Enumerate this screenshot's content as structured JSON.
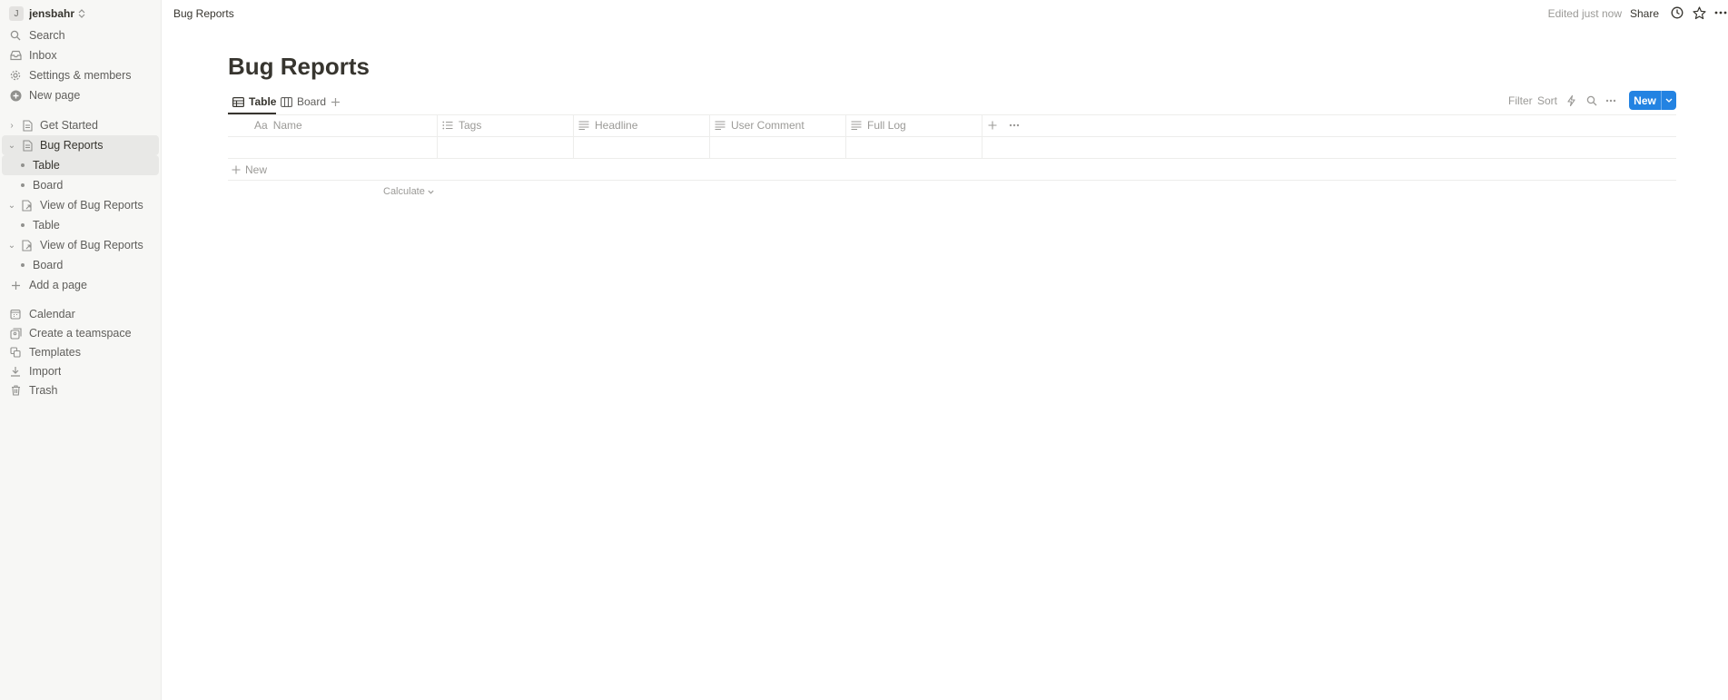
{
  "workspace": {
    "initial": "J",
    "name": "jensbahr"
  },
  "sidebar": {
    "top": [
      {
        "label": "Search",
        "icon": "search-icon"
      },
      {
        "label": "Inbox",
        "icon": "inbox-icon"
      },
      {
        "label": "Settings & members",
        "icon": "gear-icon"
      },
      {
        "label": "New page",
        "icon": "plus-circle-icon"
      }
    ],
    "pages": [
      {
        "label": "Get Started",
        "icon": "page-icon",
        "expanded": false
      },
      {
        "label": "Bug Reports",
        "icon": "page-icon",
        "expanded": true,
        "active": true
      },
      {
        "label": "Table",
        "child": true,
        "active": true
      },
      {
        "label": "Board",
        "child": true
      },
      {
        "label": "View of Bug Reports",
        "icon": "linked-page-icon",
        "expanded": true
      },
      {
        "label": "Table",
        "child": true
      },
      {
        "label": "View of Bug Reports",
        "icon": "linked-page-icon",
        "expanded": true
      },
      {
        "label": "Board",
        "child": true
      }
    ],
    "add_page": "Add a page",
    "bottom": [
      {
        "label": "Calendar",
        "icon": "calendar-icon"
      },
      {
        "label": "Create a teamspace",
        "icon": "teamspace-icon"
      },
      {
        "label": "Templates",
        "icon": "templates-icon"
      },
      {
        "label": "Import",
        "icon": "import-icon"
      },
      {
        "label": "Trash",
        "icon": "trash-icon"
      }
    ]
  },
  "topbar": {
    "breadcrumb": "Bug Reports",
    "edited": "Edited just now",
    "share": "Share"
  },
  "page": {
    "title": "Bug Reports",
    "views": [
      {
        "label": "Table",
        "active": true
      },
      {
        "label": "Board"
      }
    ],
    "tools": {
      "filter": "Filter",
      "sort": "Sort",
      "new": "New"
    },
    "columns": [
      {
        "label": "Name",
        "prefix": "Aa"
      },
      {
        "label": "Tags",
        "icon": "multiselect-icon"
      },
      {
        "label": "Headline",
        "icon": "text-icon"
      },
      {
        "label": "User Comment",
        "icon": "text-icon"
      },
      {
        "label": "Full Log",
        "icon": "text-icon"
      }
    ],
    "new_row": "New",
    "calculate": "Calculate"
  }
}
